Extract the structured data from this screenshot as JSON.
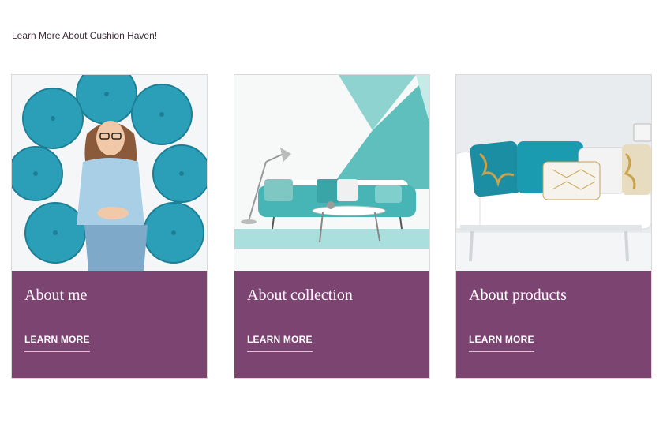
{
  "intro_text": "Learn More About Cushion Haven!",
  "accent_color": "#7b4471",
  "cards": [
    {
      "title": "About me",
      "link_label": "LEARN MORE",
      "image": "woman-with-teal-cushions"
    },
    {
      "title": "About collection",
      "link_label": "LEARN MORE",
      "image": "teal-sofa-living-room"
    },
    {
      "title": "About products",
      "link_label": "LEARN MORE",
      "image": "white-sofa-with-pillows"
    }
  ]
}
